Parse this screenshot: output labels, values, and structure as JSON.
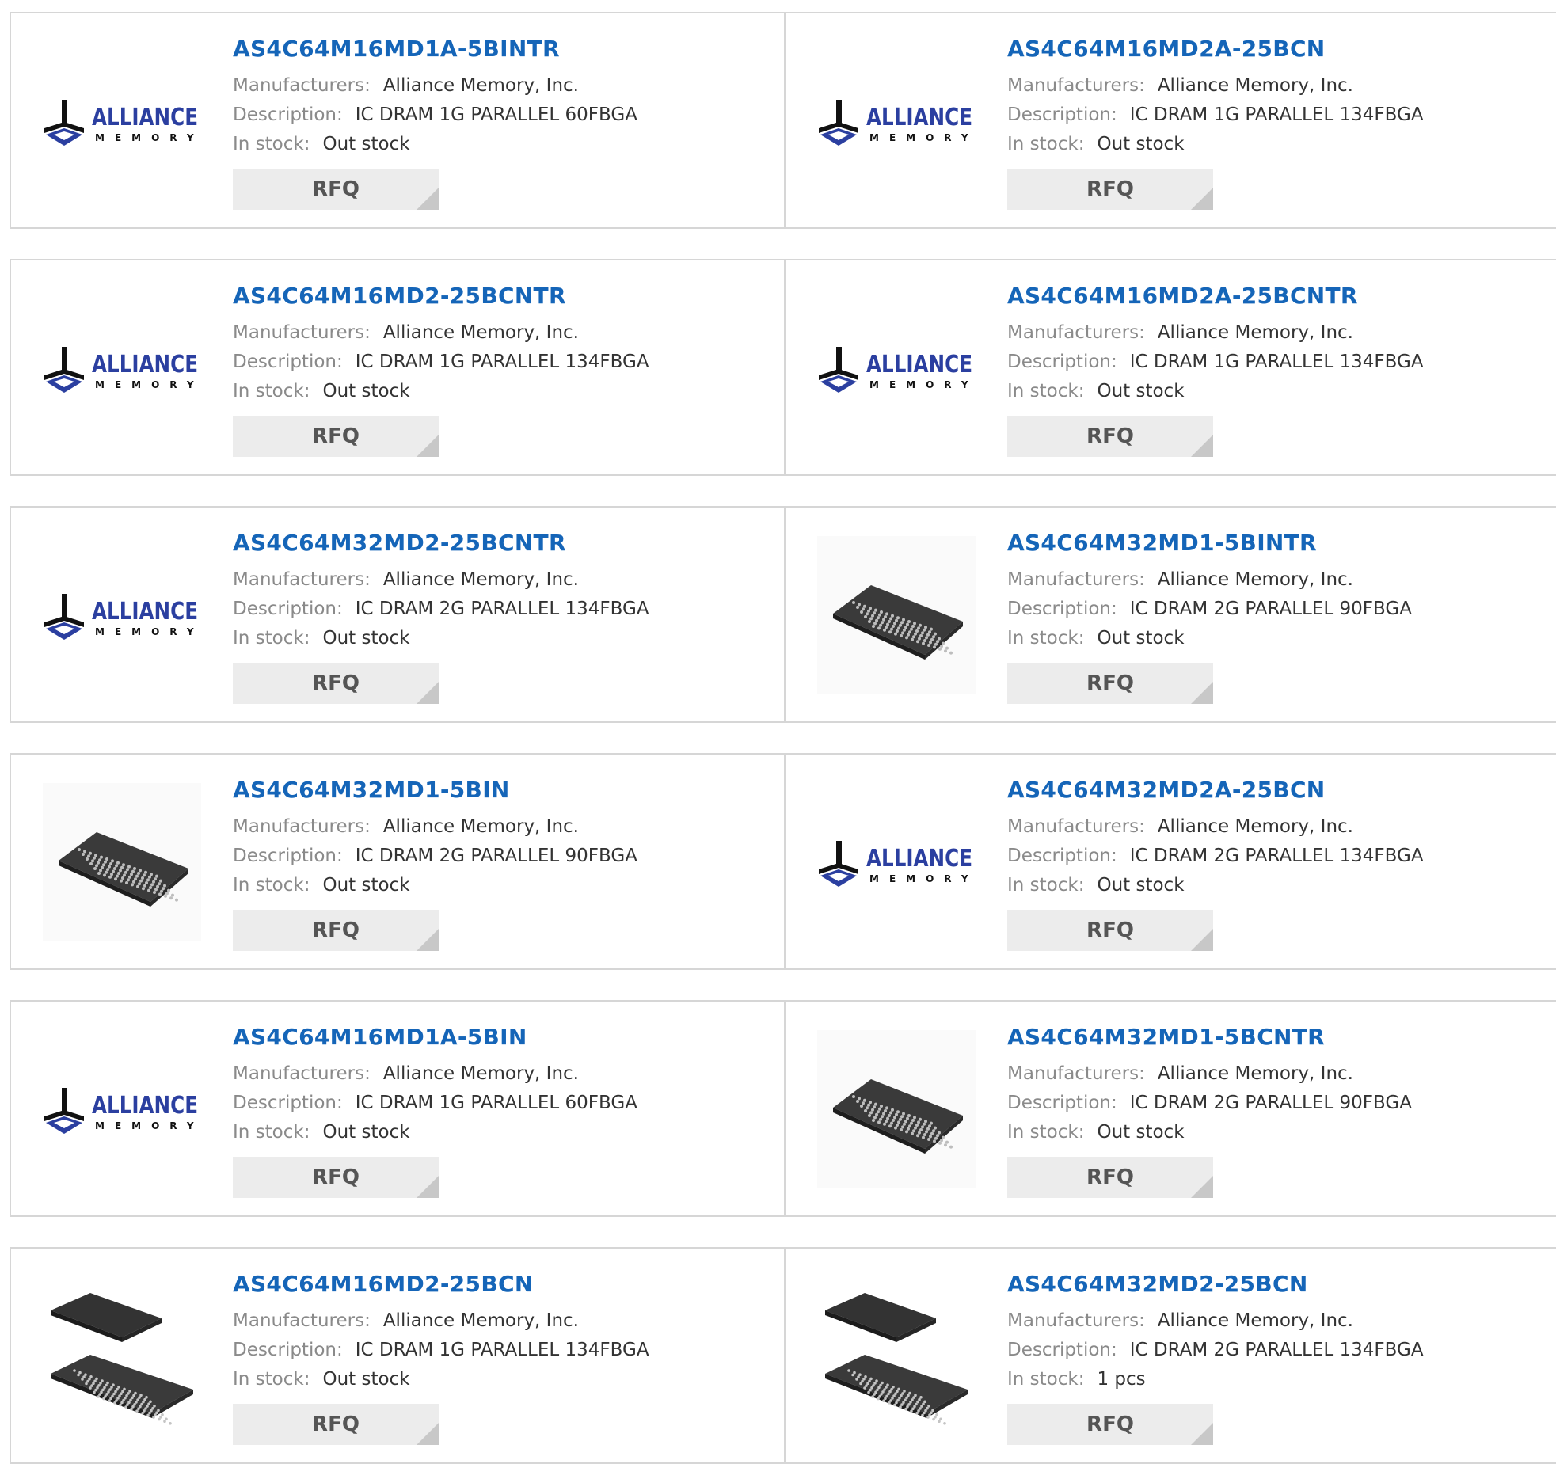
{
  "labels": {
    "manufacturers": "Manufacturers:",
    "description": "Description:",
    "in_stock": "In stock:",
    "rfq": "RFQ"
  },
  "colors": {
    "part_link": "#1565b8",
    "label": "#8a8a8a",
    "value": "#333333",
    "rfq_bg": "#ececec",
    "logo_blue": "#2b3fa0"
  },
  "products": [
    {
      "part": "AS4C64M16MD1A-5BINTR",
      "manufacturer": "Alliance Memory, Inc.",
      "description": "IC DRAM 1G PARALLEL 60FBGA",
      "stock": "Out stock",
      "image": "alliance-memory-logo"
    },
    {
      "part": "AS4C64M16MD2A-25BCN",
      "manufacturer": "Alliance Memory, Inc.",
      "description": "IC DRAM 1G PARALLEL 134FBGA",
      "stock": "Out stock",
      "image": "alliance-memory-logo"
    },
    {
      "part": "AS4C64M16MD2-25BCNTR",
      "manufacturer": "Alliance Memory, Inc.",
      "description": "IC DRAM 1G PARALLEL 134FBGA",
      "stock": "Out stock",
      "image": "alliance-memory-logo"
    },
    {
      "part": "AS4C64M16MD2A-25BCNTR",
      "manufacturer": "Alliance Memory, Inc.",
      "description": "IC DRAM 1G PARALLEL 134FBGA",
      "stock": "Out stock",
      "image": "alliance-memory-logo"
    },
    {
      "part": "AS4C64M32MD2-25BCNTR",
      "manufacturer": "Alliance Memory, Inc.",
      "description": "IC DRAM 2G PARALLEL 134FBGA",
      "stock": "Out stock",
      "image": "alliance-memory-logo"
    },
    {
      "part": "AS4C64M32MD1-5BINTR",
      "manufacturer": "Alliance Memory, Inc.",
      "description": "IC DRAM 2G PARALLEL 90FBGA",
      "stock": "Out stock",
      "image": "fbga-chip"
    },
    {
      "part": "AS4C64M32MD1-5BIN",
      "manufacturer": "Alliance Memory, Inc.",
      "description": "IC DRAM 2G PARALLEL 90FBGA",
      "stock": "Out stock",
      "image": "fbga-chip"
    },
    {
      "part": "AS4C64M32MD2A-25BCN",
      "manufacturer": "Alliance Memory, Inc.",
      "description": "IC DRAM 2G PARALLEL 134FBGA",
      "stock": "Out stock",
      "image": "alliance-memory-logo"
    },
    {
      "part": "AS4C64M16MD1A-5BIN",
      "manufacturer": "Alliance Memory, Inc.",
      "description": "IC DRAM 1G PARALLEL 60FBGA",
      "stock": "Out stock",
      "image": "alliance-memory-logo"
    },
    {
      "part": "AS4C64M32MD1-5BCNTR",
      "manufacturer": "Alliance Memory, Inc.",
      "description": "IC DRAM 2G PARALLEL 90FBGA",
      "stock": "Out stock",
      "image": "fbga-chip"
    },
    {
      "part": "AS4C64M16MD2-25BCN",
      "manufacturer": "Alliance Memory, Inc.",
      "description": "IC DRAM 1G PARALLEL 134FBGA",
      "stock": "Out stock",
      "image": "fbga-chip-pair"
    },
    {
      "part": "AS4C64M32MD2-25BCN",
      "manufacturer": "Alliance Memory, Inc.",
      "description": "IC DRAM 2G PARALLEL 134FBGA",
      "stock": "1 pcs",
      "image": "fbga-chip-pair"
    }
  ]
}
